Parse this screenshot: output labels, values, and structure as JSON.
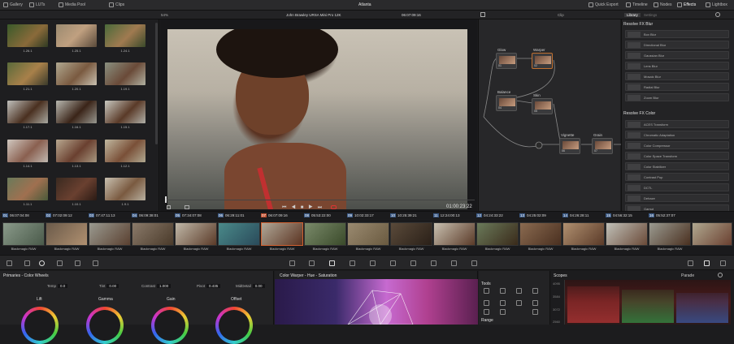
{
  "topbar": {
    "gallery": "Gallery",
    "luts": "LUTs",
    "media_pool": "Media Pool",
    "clips": "Clips",
    "project_title": "Atlanta",
    "quick_export": "Quick Export",
    "timeline": "Timeline",
    "nodes": "Nodes",
    "effects": "Effects",
    "lightbox": "Lightbox"
  },
  "toolrow": {
    "zoom": "54%",
    "camera": "John Brawley URSA Mini Pro 12K",
    "timecode": "06:07:09:16",
    "clip_mode": "Clip",
    "library_tab": "Library",
    "settings_tab": "Settings"
  },
  "gallery": {
    "stills": [
      "1.26.1",
      "1.25.1",
      "1.24.1",
      "1.21.1",
      "1.20.1",
      "1.19.1",
      "1.17.1",
      "1.16.1",
      "1.15.1",
      "1.14.1",
      "1.13.1",
      "1.12.1",
      "1.11.1",
      "1.10.1",
      "1.9.1"
    ]
  },
  "viewer": {
    "duration": "01:00:23:22"
  },
  "nodes": {
    "labels": [
      "Glow",
      "Warper",
      "Balance",
      "Skin",
      "Vignette",
      "Grain"
    ],
    "numbers": [
      "01",
      "02",
      "04",
      "05",
      "06",
      "07"
    ]
  },
  "library": {
    "blur_title": "Resolve FX Blur",
    "blur_items": [
      "Box Blur",
      "Directional Blur",
      "Gaussian Blur",
      "Lens Blur",
      "Mosaic Blur",
      "Radial Blur",
      "Zoom Blur"
    ],
    "color_title": "Resolve FX Color",
    "color_items": [
      "ACES Transform",
      "Chromatic Adaptation",
      "Color Compressor",
      "Color Space Transform",
      "Color Stabilizer",
      "Contrast Pop",
      "DCTL",
      "Dehaze",
      "Gamut"
    ]
  },
  "timeline": {
    "clips": [
      {
        "n": "01",
        "tc": "06:07:04:08"
      },
      {
        "n": "02",
        "tc": "07:02:09:12"
      },
      {
        "n": "03",
        "tc": "07:47:11:13"
      },
      {
        "n": "04",
        "tc": "06:09:38:01"
      },
      {
        "n": "05",
        "tc": "07:34:07:08"
      },
      {
        "n": "06",
        "tc": "06:29:11:01"
      },
      {
        "n": "07",
        "tc": "06:07:09:16"
      },
      {
        "n": "08",
        "tc": "05:53:22:00"
      },
      {
        "n": "09",
        "tc": "10:02:33:17"
      },
      {
        "n": "10",
        "tc": "10:25:39:21"
      },
      {
        "n": "11",
        "tc": "12:24:00:13"
      },
      {
        "n": "12",
        "tc": "04:24:33:22"
      },
      {
        "n": "13",
        "tc": "04:25:02:09"
      },
      {
        "n": "14",
        "tc": "04:26:28:11"
      },
      {
        "n": "15",
        "tc": "04:56:32:15"
      },
      {
        "n": "16",
        "tc": "05:52:37:07"
      }
    ],
    "codec": "Blackmagic RAW"
  },
  "primaries": {
    "title": "Primaries - Color Wheels",
    "temp_label": "Temp",
    "temp": "0.0",
    "tint_label": "Tint",
    "tint": "0.00",
    "contrast_label": "Contrast",
    "contrast": "1.000",
    "pivot_label": "Pivot",
    "pivot": "0.435",
    "middetail_label": "MidDetail",
    "middetail": "0.00",
    "wheels": [
      "Lift",
      "Gamma",
      "Gain",
      "Offset"
    ]
  },
  "warper": {
    "title": "Color Warper - Hue - Saturation"
  },
  "tools": {
    "title": "Tools",
    "range": "Range"
  },
  "scopes": {
    "title": "Scopes",
    "mode": "Parade",
    "ticks": [
      "4095",
      "3584",
      "3072",
      "2560"
    ]
  }
}
